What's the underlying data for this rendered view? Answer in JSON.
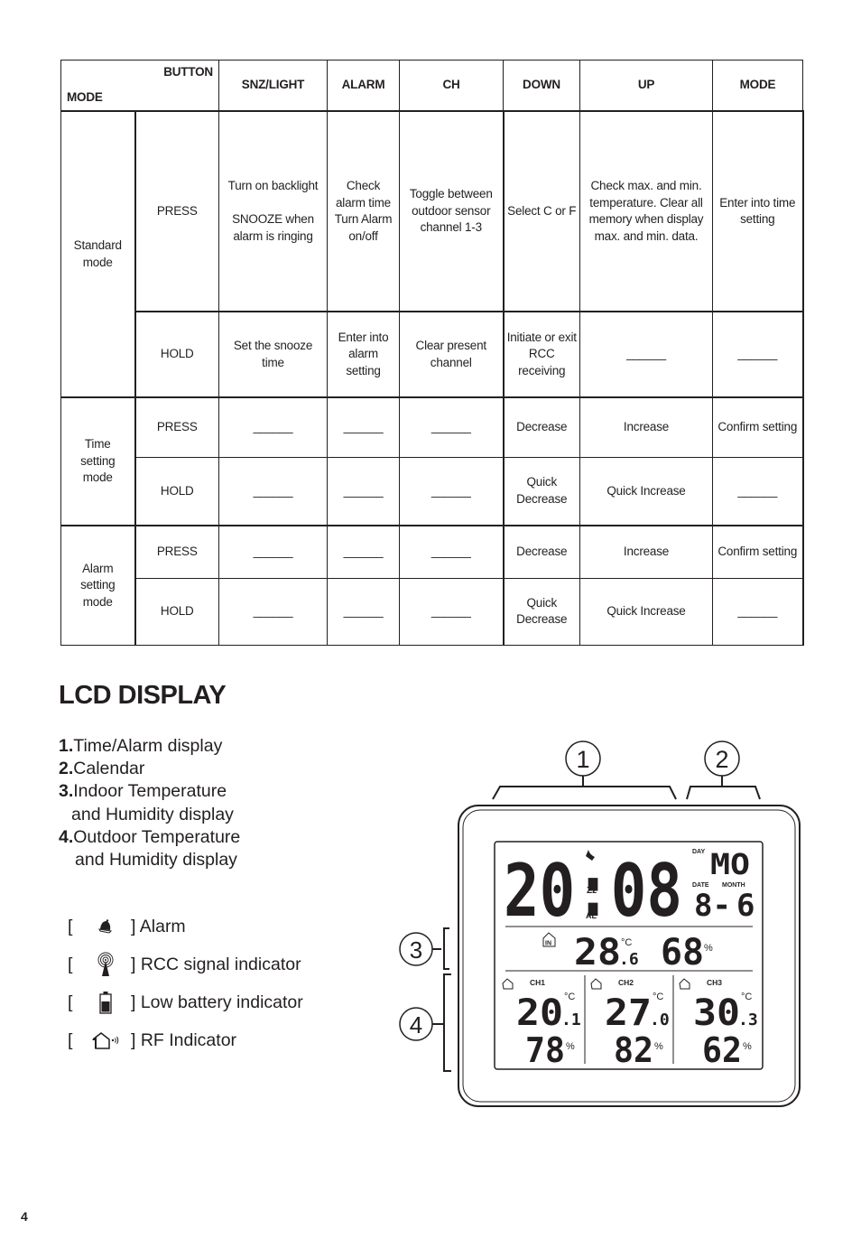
{
  "table": {
    "corner": {
      "button_label": "BUTTON",
      "mode_label": "MODE"
    },
    "columns": [
      "SNZ/LIGHT",
      "ALARM",
      "CH",
      "DOWN",
      "UP",
      "MODE"
    ],
    "groups": [
      {
        "mode": "Standard mode",
        "rows": [
          {
            "action": "PRESS",
            "cells": [
              "Turn on backlight\n\nSNOOZE when alarm is ringing",
              "Check alarm time Turn Alarm on/off",
              "Toggle between outdoor sensor channel 1-3",
              "Select C  or  F",
              "Check max. and min. temperature. Clear all memory when display max. and min. data.",
              "Enter into time setting"
            ]
          },
          {
            "action": "HOLD",
            "cells": [
              "Set the snooze time",
              "Enter into alarm setting",
              "Clear present channel",
              "Initiate or exit RCC receiving",
              "______",
              "______"
            ]
          }
        ]
      },
      {
        "mode": "Time setting mode",
        "rows": [
          {
            "action": "PRESS",
            "cells": [
              "______",
              "______",
              "______",
              "Decrease",
              "Increase",
              "Confirm setting"
            ]
          },
          {
            "action": "HOLD",
            "cells": [
              "______",
              "______",
              "______",
              "Quick Decrease",
              "Quick Increase",
              "______"
            ]
          }
        ]
      },
      {
        "mode": "Alarm setting mode",
        "rows": [
          {
            "action": "PRESS",
            "cells": [
              "______",
              "______",
              "______",
              "Decrease",
              "Increase",
              "Confirm setting"
            ]
          },
          {
            "action": "HOLD",
            "cells": [
              "______",
              "______",
              "______",
              "Quick Decrease",
              "Quick Increase",
              "______"
            ]
          }
        ]
      }
    ]
  },
  "lcd_section": {
    "title": "LCD DISPLAY",
    "items": [
      {
        "num": "1.",
        "lines": [
          "Time/Alarm display"
        ]
      },
      {
        "num": "2.",
        "lines": [
          "Calendar"
        ]
      },
      {
        "num": "3.",
        "lines": [
          "Indoor Temperature",
          "and Humidity display"
        ]
      },
      {
        "num": "4.",
        "lines": [
          "Outdoor Temperature",
          "and Humidity display"
        ]
      }
    ],
    "icons": [
      {
        "icon": "alarm-bell-icon",
        "label": "] Alarm"
      },
      {
        "icon": "rcc-signal-icon",
        "label": "] RCC signal indicator"
      },
      {
        "icon": "low-battery-icon",
        "label": "] Low battery indicator"
      },
      {
        "icon": "rf-indicator-icon",
        "label": "] RF Indicator"
      }
    ]
  },
  "device": {
    "callouts": [
      "1",
      "2",
      "3",
      "4"
    ],
    "time": "20:08",
    "day_label": "DAY",
    "day": "MO",
    "date_label": "DATE",
    "month_label": "MONTH",
    "date": "8-",
    "month": "6",
    "snooze_label": "Zz",
    "alarm_label": "AL",
    "indoor": {
      "badge": "IN",
      "temp_int": "28",
      "temp_dec": ".6",
      "temp_unit": "°C",
      "humidity": "68",
      "humidity_unit": "%"
    },
    "channels": [
      {
        "name": "CH1",
        "temp_int": "20",
        "temp_dec": ".1",
        "temp_unit": "°C",
        "humidity": "78",
        "humidity_unit": "%"
      },
      {
        "name": "CH2",
        "temp_int": "27",
        "temp_dec": ".0",
        "temp_unit": "°C",
        "humidity": "82",
        "humidity_unit": "%"
      },
      {
        "name": "CH3",
        "temp_int": "30",
        "temp_dec": ".3",
        "temp_unit": "°C",
        "humidity": "62",
        "humidity_unit": "%"
      }
    ]
  },
  "page_number": "4"
}
